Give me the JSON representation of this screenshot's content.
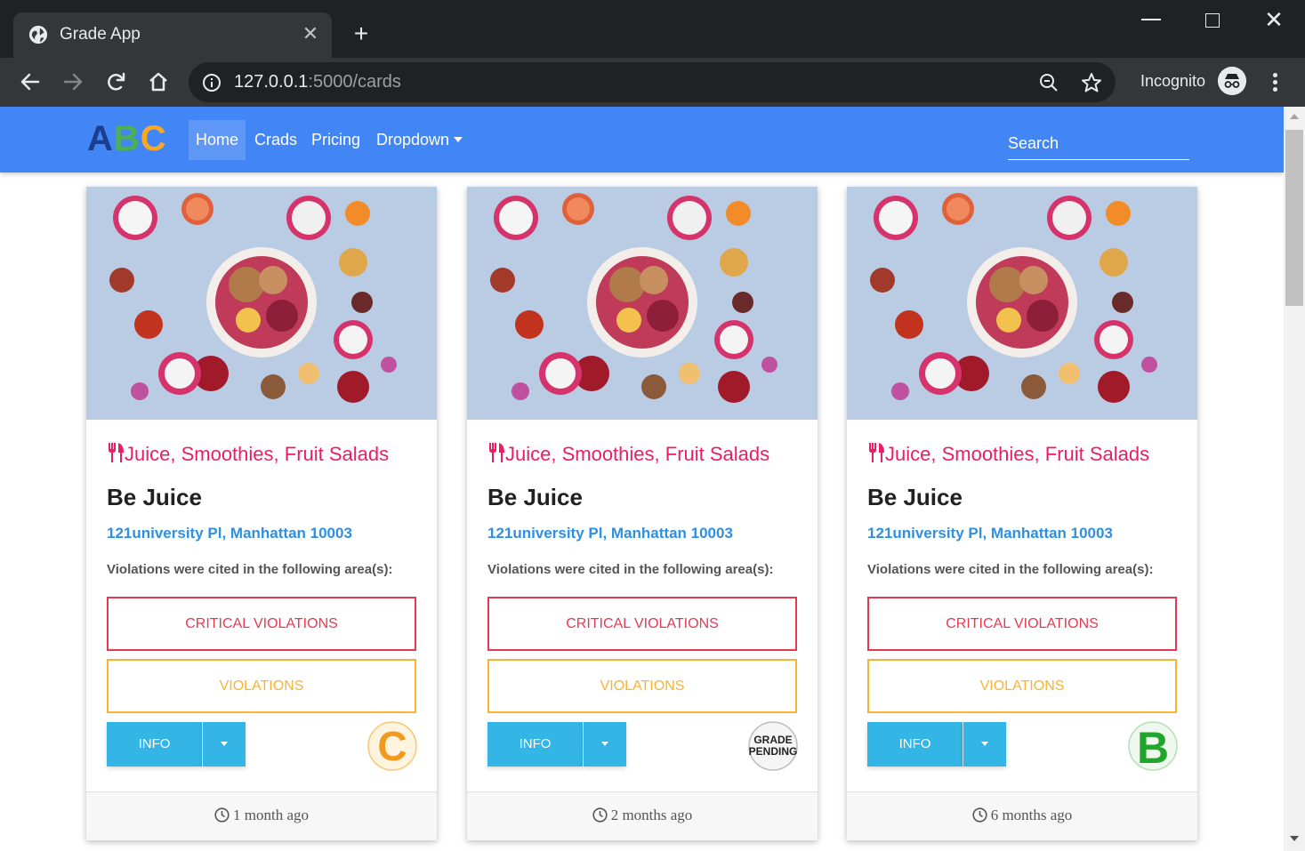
{
  "browser": {
    "tab_title": "Grade App",
    "new_tab_symbol": "+",
    "url_host": "127.0.0.1",
    "url_path": ":5000/cards",
    "profile_label": "Incognito",
    "icons": [
      "globe-icon",
      "tab-close-icon",
      "new-tab-icon",
      "back-icon",
      "forward-icon",
      "reload-icon",
      "home-icon",
      "site-info-icon",
      "zoom-icon",
      "bookmark-star-icon",
      "incognito-icon",
      "menu-kebab-icon",
      "minimize-icon",
      "maximize-icon",
      "close-icon"
    ]
  },
  "navbar": {
    "logo": {
      "a": "A",
      "b": "B",
      "c": "C"
    },
    "links": [
      "Home",
      "Crads",
      "Pricing",
      "Dropdown"
    ],
    "active_link": "Home",
    "search_placeholder": "Search",
    "color": "#4285f4"
  },
  "cards": [
    {
      "cuisine": "Juice, Smoothies, Fruit Salads",
      "name": "Be Juice",
      "address": "121university Pl, Manhattan 10003",
      "violations_text": "Violations were cited in the following area(s):",
      "critical_label": "CRITICAL VIOLATIONS",
      "violations_label": "VIOLATIONS",
      "info_label": "INFO",
      "grade": "C",
      "grade_icon": "grade-c-badge",
      "footer": "1 month ago"
    },
    {
      "cuisine": "Juice, Smoothies, Fruit Salads",
      "name": "Be Juice",
      "address": "121university Pl, Manhattan 10003",
      "violations_text": "Violations were cited in the following area(s):",
      "critical_label": "CRITICAL VIOLATIONS",
      "violations_label": "VIOLATIONS",
      "info_label": "INFO",
      "grade": "GRADE PENDING",
      "grade_icon": "grade-pending-badge",
      "footer": "2 months ago"
    },
    {
      "cuisine": "Juice, Smoothies, Fruit Salads",
      "name": "Be Juice",
      "address": "121university Pl, Manhattan 10003",
      "violations_text": "Violations were cited in the following area(s):",
      "critical_label": "CRITICAL VIOLATIONS",
      "violations_label": "VIOLATIONS",
      "info_label": "INFO",
      "grade": "B",
      "grade_icon": "grade-b-badge",
      "footer": "6 months ago"
    }
  ],
  "colors": {
    "cuisine": "#e91e63",
    "address": "#2f8fe0",
    "critical": "#e53950",
    "violations": "#fbb233",
    "info_button": "#33b5e5"
  }
}
